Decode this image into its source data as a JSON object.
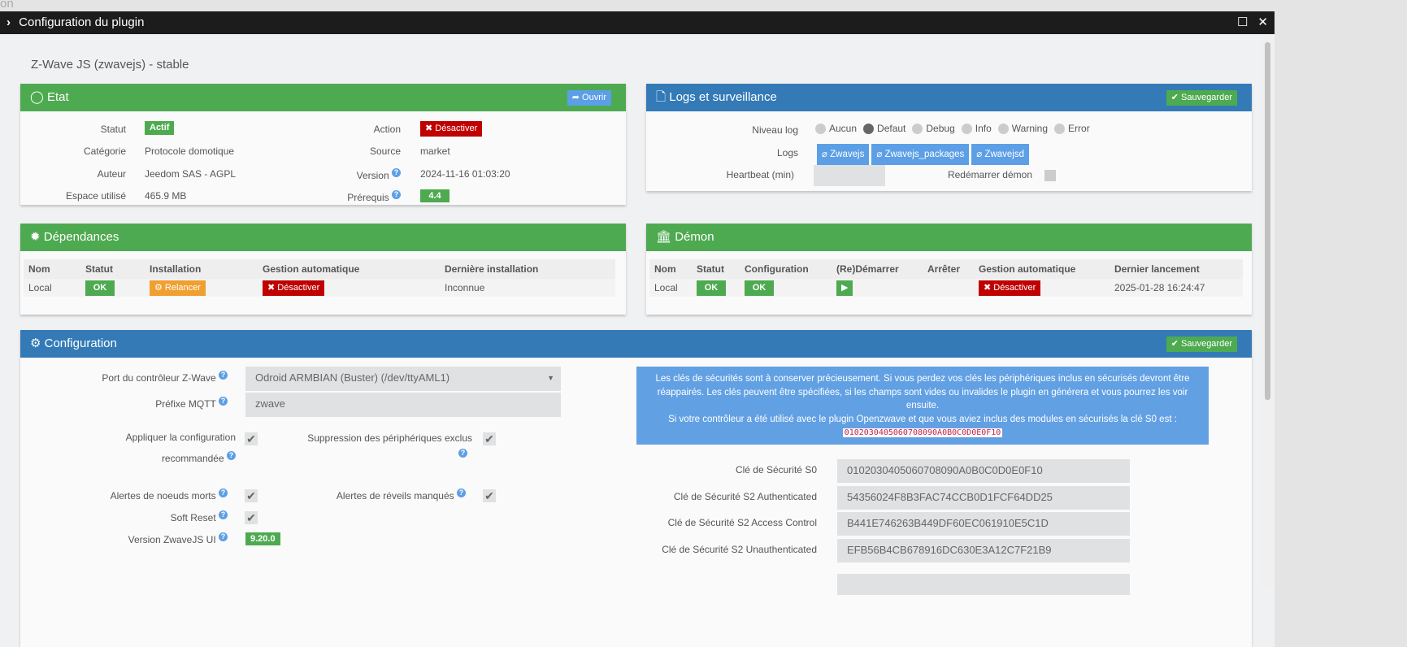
{
  "background_text": "on",
  "window": {
    "title": "Configuration du plugin"
  },
  "plugin_title": "Z-Wave JS (zwavejs) - stable",
  "etat": {
    "title": "Etat",
    "open_label": "Ouvrir",
    "statut_label": "Statut",
    "statut_value": "Actif",
    "categorie_label": "Catégorie",
    "categorie_value": "Protocole domotique",
    "auteur_label": "Auteur",
    "auteur_value": "Jeedom SAS - AGPL",
    "espace_label": "Espace utilisé",
    "espace_value": "465.9 MB",
    "action_label": "Action",
    "action_value": "Désactiver",
    "source_label": "Source",
    "source_value": "market",
    "version_label": "Version",
    "version_value": "2024-11-16 01:03:20",
    "prerequis_label": "Prérequis",
    "prerequis_value": "4.4"
  },
  "logs": {
    "title": "Logs et surveillance",
    "save_label": "Sauvegarder",
    "niveau_label": "Niveau log",
    "levels": [
      "Aucun",
      "Defaut",
      "Debug",
      "Info",
      "Warning",
      "Error"
    ],
    "selected": "Defaut",
    "logs_label": "Logs",
    "log_buttons": [
      "Zwavejs",
      "Zwavejs_packages",
      "Zwavejsd"
    ],
    "heartbeat_label": "Heartbeat (min)",
    "heartbeat_value": "",
    "restart_label": "Redémarrer démon"
  },
  "deps": {
    "title": "Dépendances",
    "headers": [
      "Nom",
      "Statut",
      "Installation",
      "Gestion automatique",
      "Dernière installation"
    ],
    "row": {
      "nom": "Local",
      "statut": "OK",
      "installation": "Relancer",
      "gestion": "Désactiver",
      "derniere": "Inconnue"
    }
  },
  "daemon": {
    "title": "Démon",
    "headers": [
      "Nom",
      "Statut",
      "Configuration",
      "(Re)Démarrer",
      "Arrêter",
      "Gestion automatique",
      "Dernier lancement"
    ],
    "row": {
      "nom": "Local",
      "statut": "OK",
      "configuration": "OK",
      "gestion": "Désactiver",
      "dernier": "2025-01-28 16:24:47"
    }
  },
  "config": {
    "title": "Configuration",
    "save_label": "Sauvegarder",
    "port_label": "Port du contrôleur Z-Wave",
    "port_value": "Odroid ARMBIAN (Buster) (/dev/ttyAML1)",
    "mqtt_label": "Préfixe MQTT",
    "mqtt_value": "zwave",
    "apply_label_1": "Appliquer la configuration",
    "apply_label_2": "recommandée",
    "suppr_label": "Suppression des périphériques exclus",
    "dead_label": "Alertes de noeuds morts",
    "wake_label": "Alertes de réveils manqués",
    "soft_label": "Soft Reset",
    "version_label": "Version ZwaveJS UI",
    "version_value": "9.20.0",
    "info_text_1": "Les clés de sécurités sont à conserver précieusement. Si vous perdez vos clés les périphériques inclus en sécurisés devront être réappairés. Les clés peuvent être spécifiées, si les champs sont vides ou invalides le plugin en générera et vous pourrez les voir ensuite.",
    "info_text_2": "Si votre contrôleur a été utilisé avec le plugin Openzwave et que vous aviez inclus des modules en sécurisés la clé S0 est :",
    "info_code": "0102030405060708090A0B0C0D0E0F10",
    "keys": [
      {
        "label": "Clé de Sécurité S0",
        "value": "0102030405060708090A0B0C0D0E0F10"
      },
      {
        "label": "Clé de Sécurité S2 Authenticated",
        "value": "54356024F8B3FAC74CCB0D1FCF64DD25"
      },
      {
        "label": "Clé de Sécurité S2 Access Control",
        "value": "B441E746263B449DF60EC061910E5C1D"
      },
      {
        "label": "Clé de Sécurité S2 Unauthenticated",
        "value": "EFB56B4CB678916DC630E3A12C7F21B9"
      }
    ]
  }
}
